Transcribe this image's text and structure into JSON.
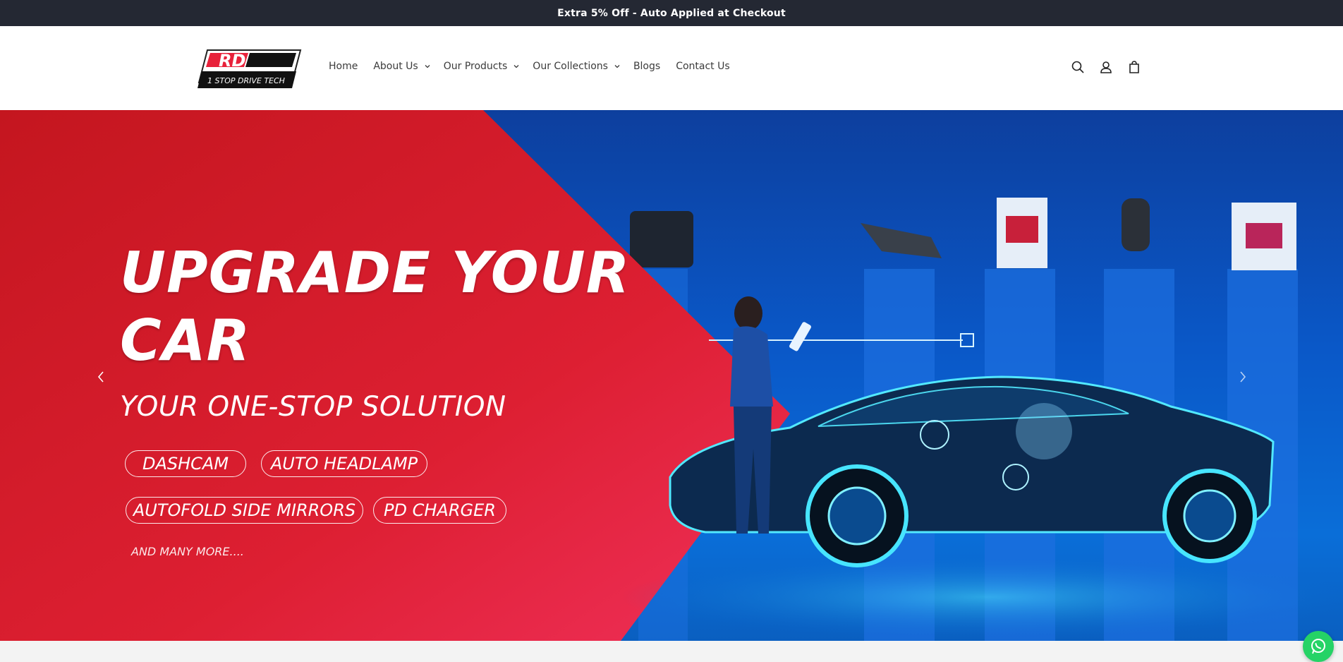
{
  "announcement": {
    "text": "Extra 5% Off - Auto Applied at Checkout"
  },
  "header": {
    "logo": {
      "mark_text": "RD",
      "tagline": "1 STOP DRIVE TECH"
    },
    "nav": [
      {
        "label": "Home",
        "dropdown": false
      },
      {
        "label": "About Us",
        "dropdown": true
      },
      {
        "label": "Our Products",
        "dropdown": true
      },
      {
        "label": "Our Collections",
        "dropdown": true
      },
      {
        "label": "Blogs",
        "dropdown": false
      },
      {
        "label": "Contact Us",
        "dropdown": false
      }
    ],
    "icons": [
      "search-icon",
      "account-icon",
      "cart-icon"
    ]
  },
  "hero": {
    "headline_line1": "UPGRADE YOUR",
    "headline_line2": "CAR",
    "subheadline": "YOUR ONE-STOP SOLUTION",
    "pills": [
      "DASHCAM",
      "AUTO HEADLAMP",
      "AUTOFOLD SIDE MIRRORS",
      "PD CHARGER"
    ],
    "more": "AND MANY MORE....",
    "colors": {
      "red": "#e8213a",
      "blue": "#0a6ed8",
      "cyan": "#3ee6ff"
    }
  },
  "floating": {
    "whatsapp_icon": "whatsapp-icon"
  }
}
